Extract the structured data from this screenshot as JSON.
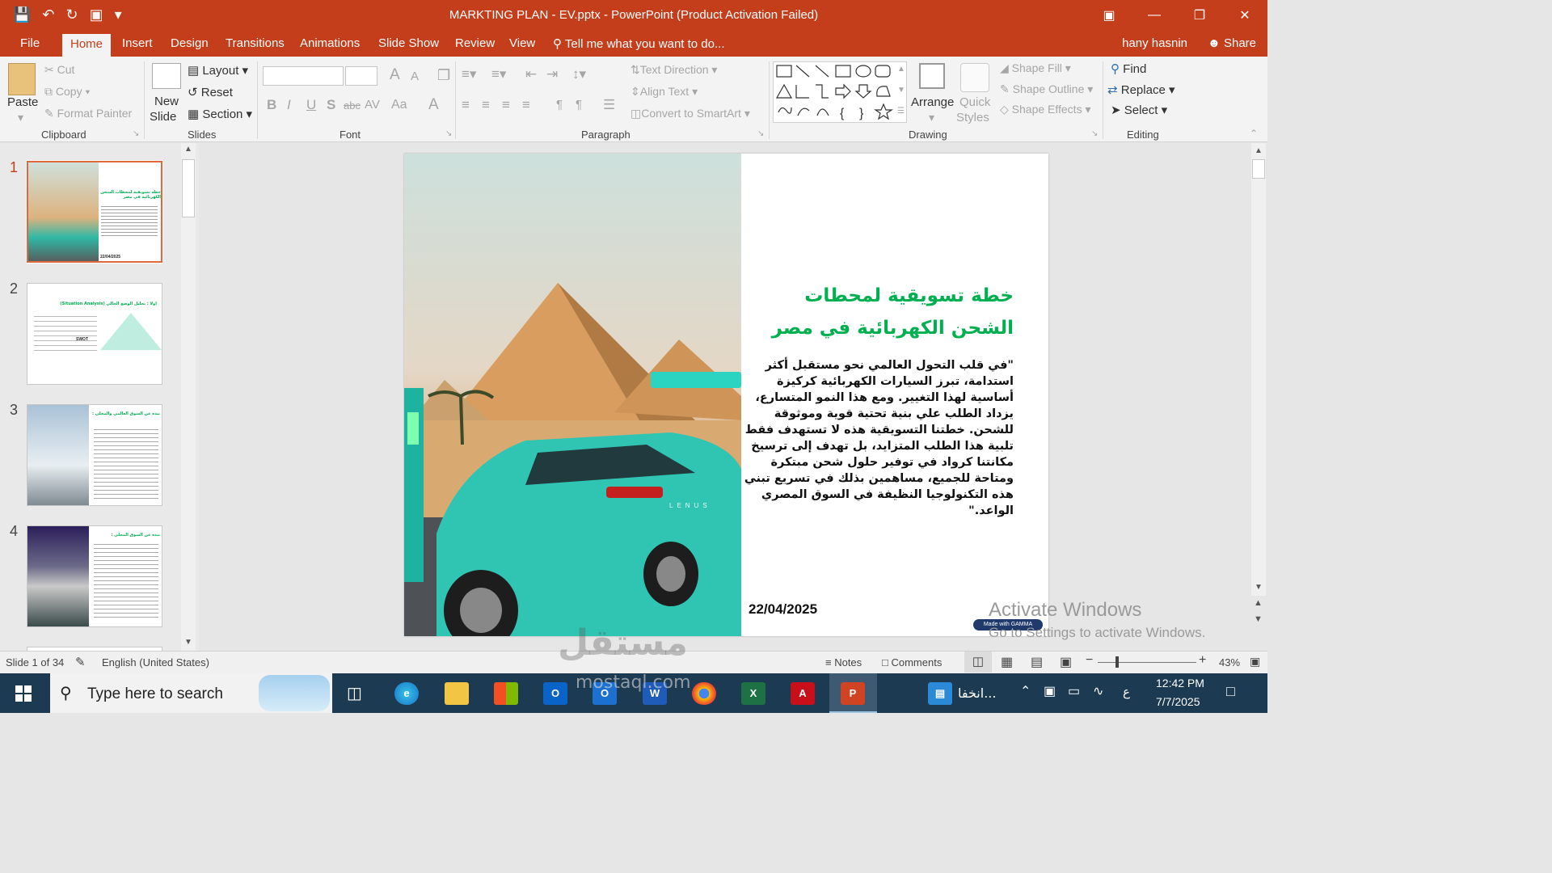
{
  "title_bar": {
    "quick_access": [
      "save-icon",
      "undo-icon",
      "redo-icon",
      "present-icon",
      "customize-icon"
    ],
    "title": "MARKTING PLAN - EV.pptx - PowerPoint (Product Activation Failed)",
    "controls": [
      "ribbon-display-icon",
      "minimize-icon",
      "restore-icon",
      "close-icon"
    ]
  },
  "tabs": [
    "File",
    "Home",
    "Insert",
    "Design",
    "Transitions",
    "Animations",
    "Slide Show",
    "Review",
    "View"
  ],
  "tell_me": "Tell me what you want to do...",
  "user": "hany hasnin",
  "share": "Share",
  "ribbon": {
    "clipboard": {
      "paste": "Paste",
      "cut": "Cut",
      "copy": "Copy",
      "format_painter": "Format Painter",
      "label": "Clipboard"
    },
    "slides": {
      "new_slide_1": "New",
      "new_slide_2": "Slide",
      "layout": "Layout",
      "reset": "Reset",
      "section": "Section",
      "label": "Slides"
    },
    "font": {
      "bold": "B",
      "italic": "I",
      "underline": "U",
      "shadow": "S",
      "strike": "abc",
      "spacing": "AV",
      "case": "Aa",
      "color": "A",
      "grow": "A",
      "shrink": "A",
      "label": "Font"
    },
    "paragraph": {
      "text_direction": "Text Direction",
      "align_text": "Align Text",
      "convert_smartart": "Convert to SmartArt",
      "label": "Paragraph"
    },
    "drawing": {
      "arrange": "Arrange",
      "quick_1": "Quick",
      "quick_2": "Styles",
      "shape_fill": "Shape Fill",
      "shape_outline": "Shape Outline",
      "shape_effects": "Shape Effects",
      "label": "Drawing"
    },
    "editing": {
      "find": "Find",
      "replace": "Replace",
      "select": "Select",
      "label": "Editing"
    }
  },
  "thumbnails": [
    {
      "number": "1",
      "title": "خطة تسويقية لمحطات الشحن الكهربائية في مصر",
      "date": "22/04/2025"
    },
    {
      "number": "2",
      "title": "اولا : تحليل الوضع الحالي (Situation Analysis)",
      "label": "SWOT"
    },
    {
      "number": "3",
      "title": "نبذه عن السوق العالمي والمحلي :"
    },
    {
      "number": "4",
      "title": "نبذه عن السوق المحلي :"
    }
  ],
  "slide": {
    "title": "خطة تسويقية لمحطات الشحن الكهربائية في مصر",
    "body": "\"في قلب التحول العالمي نحو مستقبل أكثر استدامة، تبرز السيارات الكهربائية كركيزة أساسية لهذا التغيير. ومع هذا النمو المتسارع، يزداد الطلب علي بنية تحتية قوية وموثوقة للشحن. خطتنا التسويقية هذه لا تستهدف فقط تلبية هذا الطلب المتزايد، بل تهدف إلى ترسيخ مكانتنا كرواد في توفير حلول شحن مبتكرة ومتاحة للجميع، مساهمين بذلك في تسريع تبني هذه التكنولوجيا النظيفة في السوق المصري الواعد.\"",
    "date": "22/04/2025",
    "badge": "Made with GAMMA",
    "car_badge": "LENUS"
  },
  "activation": {
    "line1": "Activate Windows",
    "line2": "Go to Settings to activate Windows."
  },
  "status": {
    "slide_info": "Slide 1 of 34",
    "language": "English (United States)",
    "notes": "Notes",
    "comments": "Comments",
    "zoom_level": "43%",
    "zoom_fraction": 0.43
  },
  "taskbar": {
    "search_placeholder": "Type here to search",
    "pinned": [
      "task-view-icon",
      "edge-icon",
      "file-explorer-icon",
      "store-icon",
      "outlook-icon",
      "outlook-new-icon",
      "word-icon",
      "chrome-icon",
      "excel-icon",
      "acrobat-icon",
      "powerpoint-icon"
    ],
    "news": "انخفا...",
    "lang": "ع",
    "time": "12:42 PM",
    "date": "7/7/2025"
  },
  "overlay_watermark": {
    "logo": "مستقل",
    "url": "mostaql.com"
  },
  "colors": {
    "accent": "#c43e1c",
    "slide_title": "#00b050",
    "taskbar": "#1c3a52"
  }
}
